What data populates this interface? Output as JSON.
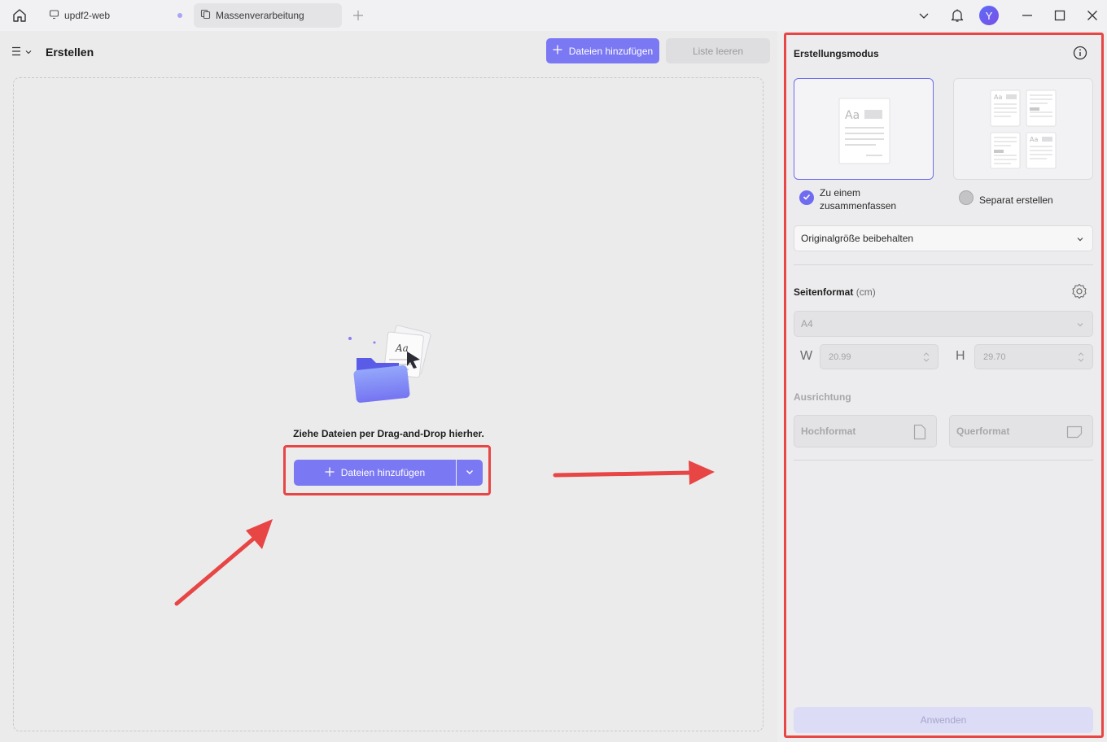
{
  "titlebar": {
    "tabs": [
      {
        "label": "updf2-web"
      },
      {
        "label": "Massenverarbeitung"
      }
    ],
    "avatar_initial": "Y"
  },
  "left": {
    "title": "Erstellen",
    "add_files_label": "Dateien hinzufügen",
    "clear_list_label": "Liste leeren",
    "drop_hint": "Ziehe Dateien per Drag-and-Drop hierher.",
    "center_add_label": "Dateien hinzufügen"
  },
  "right": {
    "mode_title": "Erstellungsmodus",
    "option_merge": "Zu einem zusammenfassen",
    "option_separate": "Separat erstellen",
    "size_select": "Originalgröße beibehalten",
    "page_format_title": "Seitenformat",
    "page_format_unit": "(cm)",
    "format_select": "A4",
    "w_label": "W",
    "w_value": "20.99",
    "h_label": "H",
    "h_value": "29.70",
    "orientation_title": "Ausrichtung",
    "portrait_label": "Hochformat",
    "landscape_label": "Querformat",
    "apply_label": "Anwenden"
  },
  "colors": {
    "accent": "#7b78f4",
    "highlight": "#e84545"
  }
}
